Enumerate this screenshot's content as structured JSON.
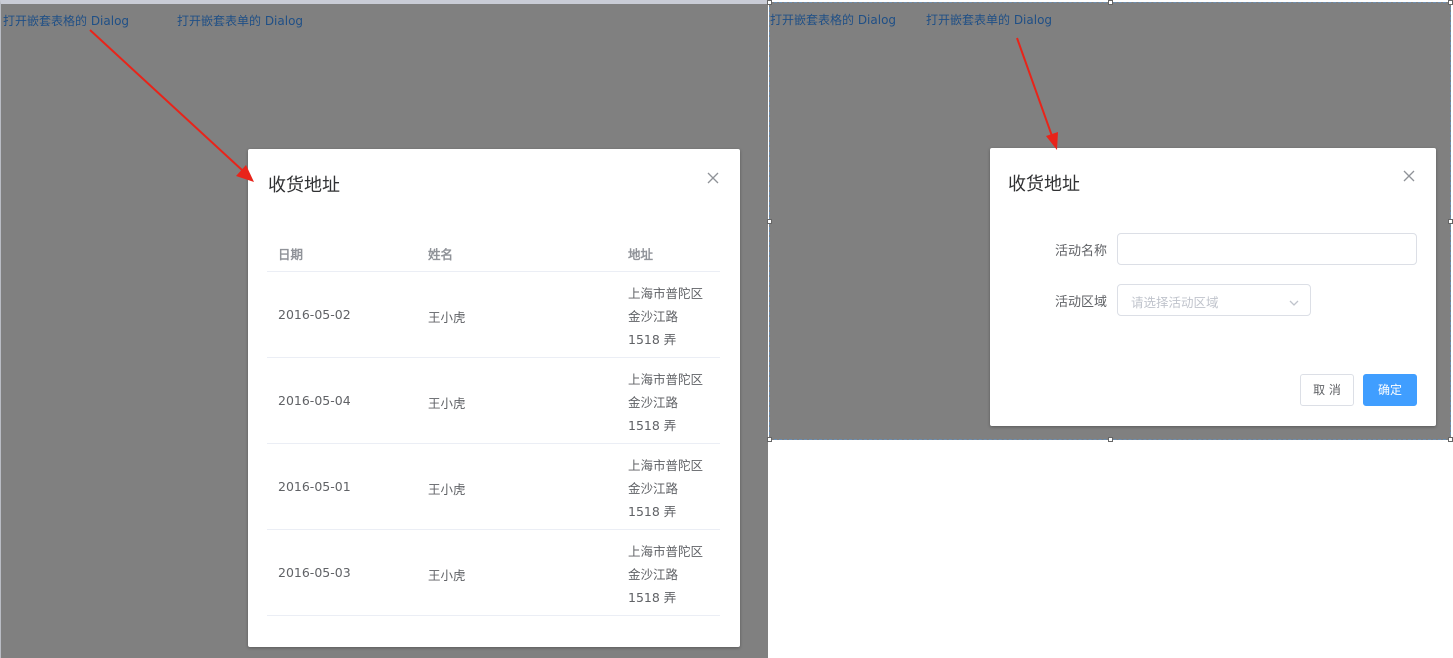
{
  "left_panel": {
    "links": [
      "打开嵌套表格的 Dialog",
      "打开嵌套表单的 Dialog"
    ],
    "dialog": {
      "title": "收货地址",
      "columns": [
        "日期",
        "姓名",
        "地址"
      ],
      "rows": [
        {
          "date": "2016-05-02",
          "name": "王小虎",
          "address": "上海市普陀区金沙江路 1518 弄"
        },
        {
          "date": "2016-05-04",
          "name": "王小虎",
          "address": "上海市普陀区金沙江路 1518 弄"
        },
        {
          "date": "2016-05-01",
          "name": "王小虎",
          "address": "上海市普陀区金沙江路 1518 弄"
        },
        {
          "date": "2016-05-03",
          "name": "王小虎",
          "address": "上海市普陀区金沙江路 1518 弄"
        }
      ]
    }
  },
  "right_panel": {
    "links": [
      "打开嵌套表格的 Dialog",
      "打开嵌套表单的 Dialog"
    ],
    "dialog": {
      "title": "收货地址",
      "form": {
        "name_label": "活动名称",
        "name_value": "",
        "region_label": "活动区域",
        "region_placeholder": "请选择活动区域"
      },
      "cancel_label": "取 消",
      "confirm_label": "确定"
    }
  },
  "colors": {
    "overlay": "#808080",
    "primary": "#409eff",
    "annotation_arrow": "#e8241a",
    "link": "#1f4f86"
  },
  "icons": [
    "close-icon",
    "chevron-down-icon",
    "annotation-arrow"
  ]
}
